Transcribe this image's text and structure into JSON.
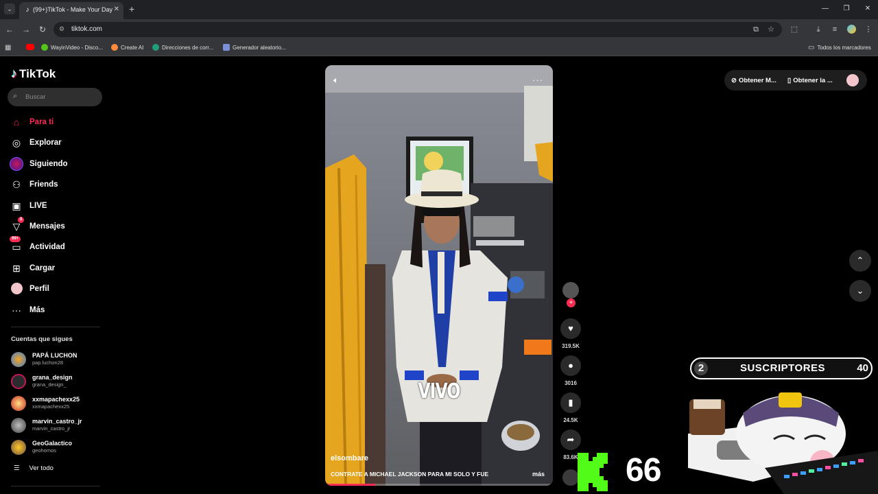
{
  "browser": {
    "tab_title": "(99+)TikTok - Make Your Day",
    "url": "tiktok.com",
    "bookmarks": [
      "WayinVideo - Disco...",
      "Create AI",
      "Direcciones de corr...",
      "Generador aleatorio..."
    ],
    "all_bookmarks": "Todos los marcadores"
  },
  "tiktok": {
    "logo": "TikTok",
    "search_placeholder": "Buscar",
    "nav": [
      {
        "label": "Para ti",
        "icon": "home-icon",
        "active": true
      },
      {
        "label": "Explorar",
        "icon": "compass-icon"
      },
      {
        "label": "Siguiendo",
        "icon": "following-icon"
      },
      {
        "label": "Friends",
        "icon": "friends-icon"
      },
      {
        "label": "LIVE",
        "icon": "live-icon"
      },
      {
        "label": "Mensajes",
        "icon": "messages-icon",
        "badge": "8"
      },
      {
        "label": "Actividad",
        "icon": "activity-icon",
        "badge": "99+"
      },
      {
        "label": "Cargar",
        "icon": "upload-icon"
      },
      {
        "label": "Perfil",
        "icon": "profile-icon"
      },
      {
        "label": "Más",
        "icon": "more-icon"
      }
    ],
    "following_title": "Cuentas que sigues",
    "following": [
      {
        "name": "PAPÁ LUCHON",
        "user": "pap.luchon28"
      },
      {
        "name": "grana_design",
        "user": "grana_design_"
      },
      {
        "name": "xxmapachexx25",
        "user": "xxmapachexx25"
      },
      {
        "name": "marvin_castro_jr",
        "user": "marvin_castro_jr"
      },
      {
        "name": "GeoGalactico",
        "user": "geohomos"
      }
    ],
    "see_all": "Ver todo",
    "video": {
      "author": "elsombare",
      "description": "CONTRATE A MICHAEL JACKSON PARA MI SOLO Y FUE",
      "more": "más",
      "overlay_text": "VIVO",
      "progress": 0.22
    },
    "actions": {
      "likes": "319.5K",
      "comments": "3016",
      "saves": "24.5K",
      "shares": "83.6K"
    },
    "top": {
      "get_m": "Obtener M...",
      "get_app": "Obtener la ..."
    }
  },
  "stream_overlay": {
    "subs_label": "SUSCRIPTORES",
    "subs_current": "2",
    "subs_goal": "40",
    "kick_count": "66"
  },
  "colors": {
    "accent": "#fe2c55",
    "kick": "#53fc18"
  }
}
